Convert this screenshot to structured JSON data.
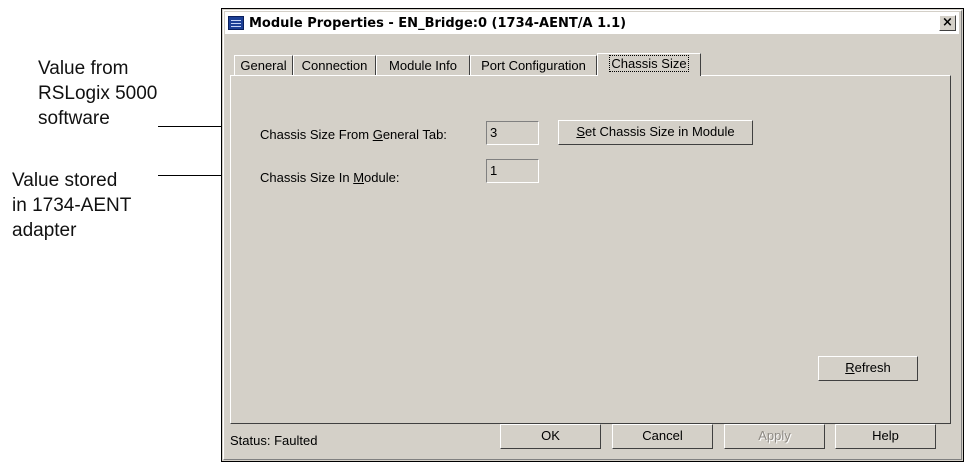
{
  "annotations": {
    "callout1": [
      "Value from",
      "RSLogix 5000",
      "software"
    ],
    "callout2": [
      "Value stored",
      "in 1734-AENT",
      "adapter"
    ]
  },
  "window": {
    "title": "Module Properties - EN_Bridge:0 (1734-AENT/A 1.1)",
    "close_label": "×"
  },
  "tabs": [
    {
      "label": "General"
    },
    {
      "label": "Connection"
    },
    {
      "label": "Module Info"
    },
    {
      "label": "Port Configuration"
    },
    {
      "label": "Chassis Size",
      "active": true
    }
  ],
  "chassis": {
    "from_general_label_pre": "Chassis Size From ",
    "from_general_label_key": "G",
    "from_general_label_post": "eneral Tab:",
    "from_general_value": "3",
    "in_module_label_pre": "Chassis Size In ",
    "in_module_label_key": "M",
    "in_module_label_post": "odule:",
    "in_module_value": "1",
    "set_button_key": "S",
    "set_button_rest": "et Chassis Size in Module",
    "refresh_key": "R",
    "refresh_rest": "efresh"
  },
  "footer": {
    "status": "Status:  Faulted",
    "ok": "OK",
    "cancel": "Cancel",
    "apply": "Apply",
    "help": "Help"
  },
  "colors": {
    "dialog_face": "#d4d0c8",
    "title_icon": "#1c3f95"
  }
}
